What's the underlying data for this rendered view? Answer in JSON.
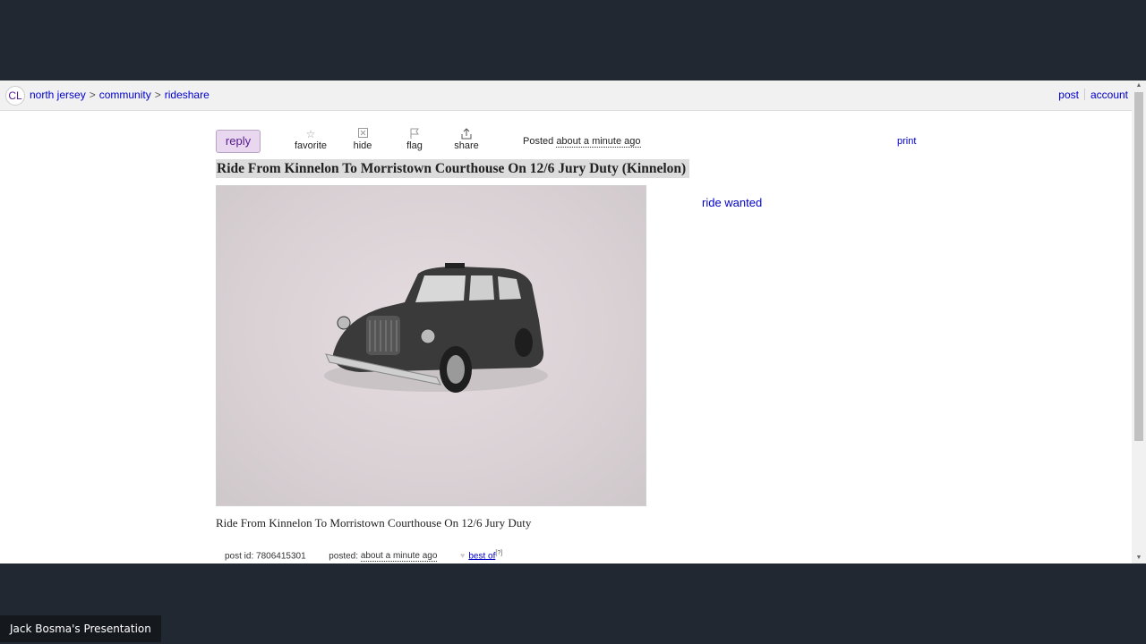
{
  "header": {
    "logo": "CL",
    "breadcrumb": [
      "north jersey",
      "community",
      "rideshare"
    ],
    "separator": ">",
    "right_links": [
      "post",
      "account"
    ]
  },
  "toolbar": {
    "reply": "reply",
    "actions": [
      {
        "label": "favorite",
        "icon": "star-icon"
      },
      {
        "label": "hide",
        "icon": "hide-icon"
      },
      {
        "label": "flag",
        "icon": "flag-icon"
      },
      {
        "label": "share",
        "icon": "share-icon"
      }
    ],
    "posted_prefix": "Posted",
    "posted_time": "about a minute ago",
    "print": "print"
  },
  "posting": {
    "title": "Ride From Kinnelon To Morristown Courthouse On 12/6 Jury Duty (Kinnelon)",
    "category": "ride wanted",
    "description": "Ride From Kinnelon To Morristown Courthouse On 12/6 Jury Duty",
    "image_icon": "taxi-cab-icon"
  },
  "footer": {
    "post_id_label": "post id:",
    "post_id": "7806415301",
    "posted_label": "posted:",
    "posted_time": "about a minute ago",
    "best_of": "best of",
    "best_of_sup": "[?]"
  },
  "presenter": {
    "label": "Jack Bosma's Presentation"
  },
  "colors": {
    "link": "#0000cc",
    "reply_bg": "#e9d7f0",
    "page_bg": "#222831"
  }
}
